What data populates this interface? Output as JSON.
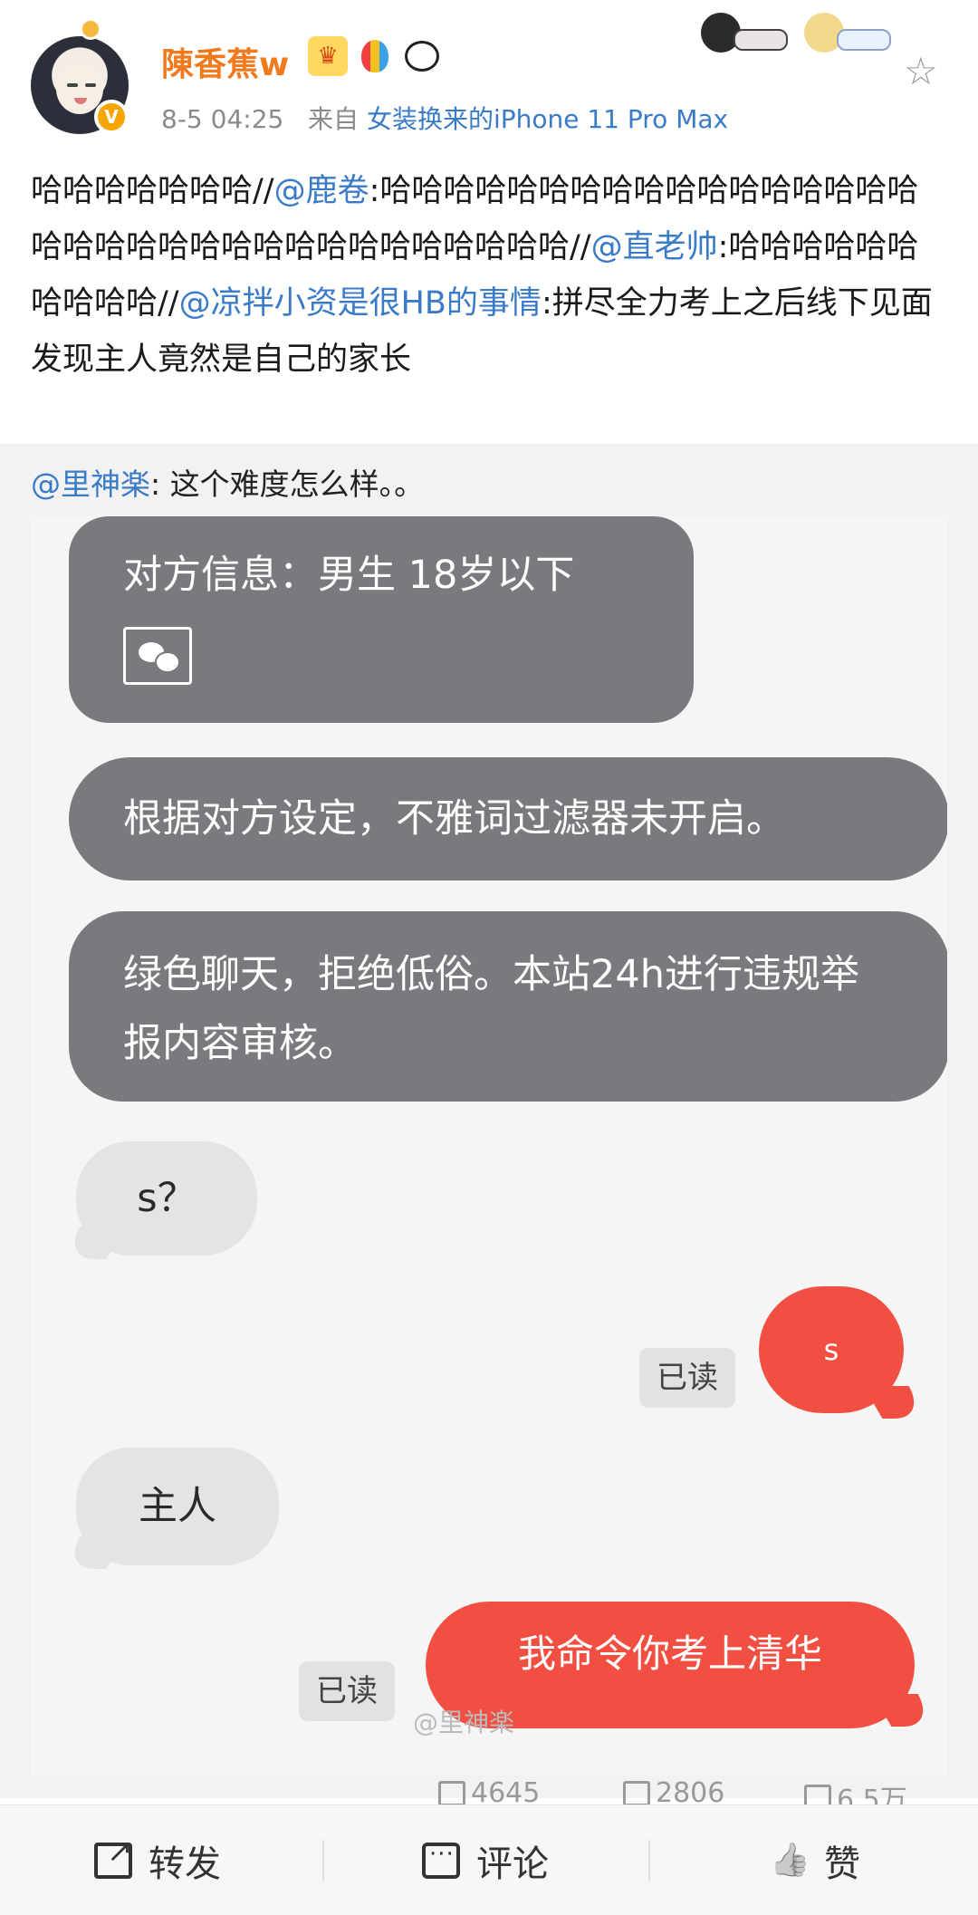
{
  "user": {
    "name": "陳香蕉w",
    "time": "8-5 04:25",
    "source_prefix": "来自",
    "source": "女装换来的iPhone 11 Pro Max"
  },
  "post": {
    "t1": "哈哈哈哈哈哈哈//",
    "m1": "@鹿卷",
    "t2": ":哈哈哈哈哈哈哈哈哈哈哈哈哈哈哈哈哈哈哈哈哈哈哈哈哈哈哈哈哈哈哈哈哈哈//",
    "m2": "@直老帅",
    "t3": ":哈哈哈哈哈哈哈哈哈哈//",
    "m3": "@凉拌小资是很HB的事情",
    "t4": ":拼尽全力考上之后线下见面发现主人竟然是自己的家长"
  },
  "repost": {
    "mention": "@里神楽",
    "text": ": 这个难度怎么样。。"
  },
  "chat": {
    "msg1": "对方信息：男生 18岁以下",
    "msg2": "根据对方设定，不雅词过滤器未开启。",
    "msg3": "绿色聊天，拒绝低俗。本站24h进行违规举报内容审核。",
    "msg4": "s？",
    "msg5": "s",
    "read1": "已读",
    "msg6": "主人",
    "msg7": "我命令你考上清华",
    "read2": "已读",
    "watermark": "@里神楽"
  },
  "counts": {
    "reposts": "4645",
    "comments": "2806",
    "likes": "6.5万"
  },
  "actions": {
    "repost": "转发",
    "comment": "评论",
    "like": "赞"
  },
  "icons": {
    "avatar_badge": "verified-v-icon",
    "favorite": "star-icon"
  }
}
